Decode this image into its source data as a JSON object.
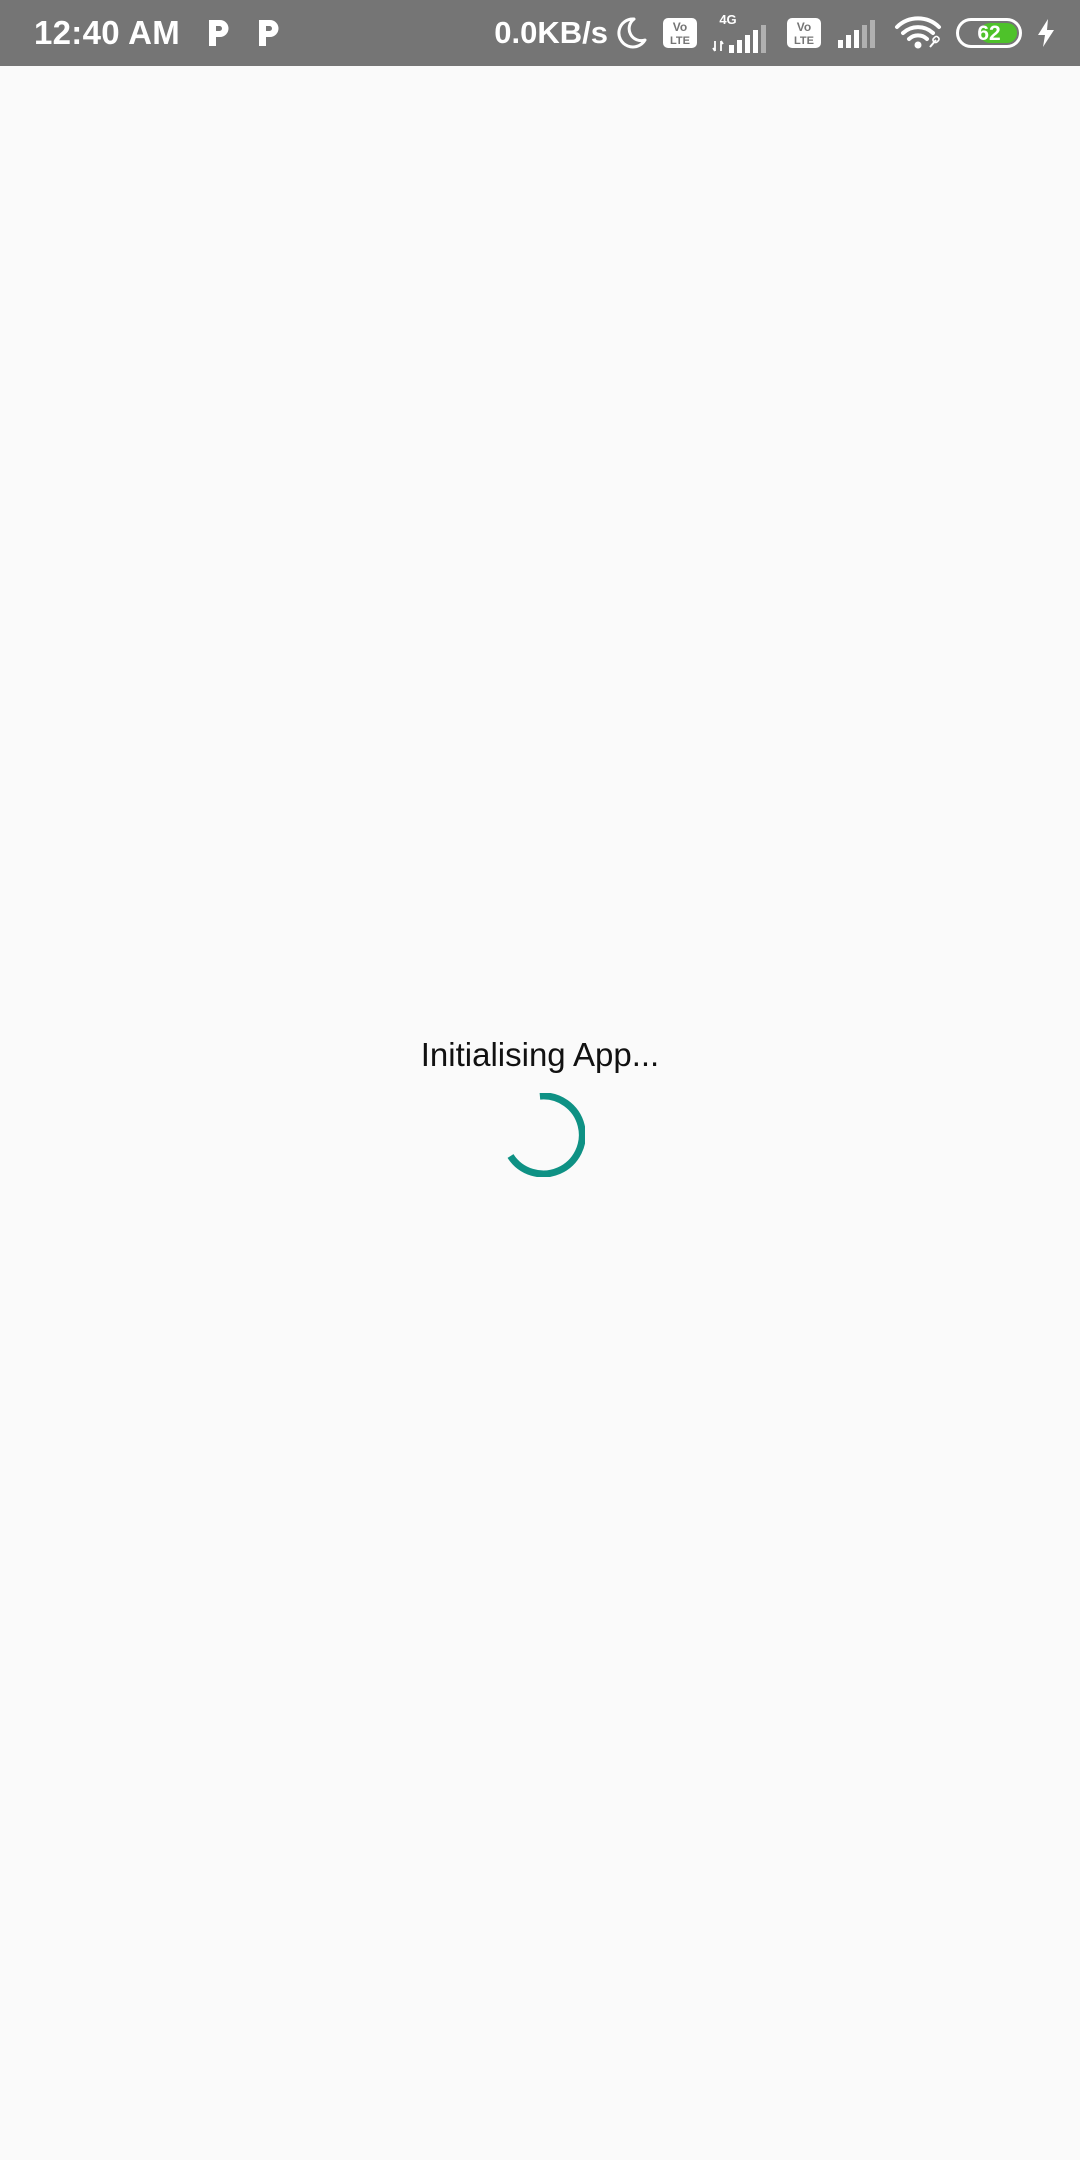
{
  "status_bar": {
    "time": "12:40 AM",
    "notification_icons": [
      "p-icon",
      "p-icon"
    ],
    "network_speed": "0.0KB/s",
    "dnd_icon": "moon-icon",
    "sim1": {
      "volte_top": "Vo",
      "volte_bottom": "LTE",
      "network_type": "4G"
    },
    "sim2": {
      "volte_top": "Vo",
      "volte_bottom": "LTE"
    },
    "wifi_icon": "wifi-icon",
    "battery_level": "62",
    "battery_fraction": 0.62,
    "charging_icon": "bolt-icon",
    "colors": {
      "background": "#757575",
      "battery_fill": "#4ec22a"
    }
  },
  "main": {
    "loading_text": "Initialising App...",
    "spinner_icon": "loading-spinner-icon",
    "spinner_color": "#0e9184",
    "background": "#fafafa"
  }
}
